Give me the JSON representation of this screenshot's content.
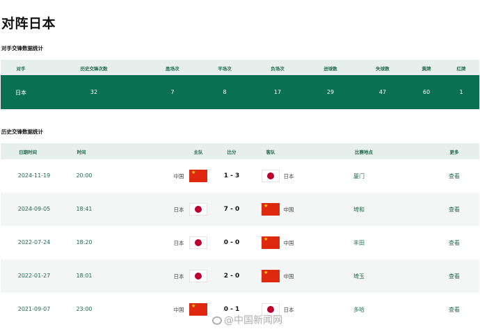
{
  "page": {
    "title": "对阵日本"
  },
  "stats": {
    "section_title": "对手交锋数据统计",
    "headers": [
      "对手",
      "历史交锋次数",
      "胜场次",
      "平场次",
      "负场次",
      "进球数",
      "失球数",
      "黄牌",
      "红牌"
    ],
    "row": [
      "日本",
      "32",
      "7",
      "8",
      "17",
      "29",
      "47",
      "60",
      "1"
    ]
  },
  "matches": {
    "section_title": "历史交锋数据统计",
    "headers": [
      "日期时间",
      "时间",
      "主队",
      "比分",
      "客队",
      "比赛地点",
      "更多"
    ],
    "rows": [
      {
        "date": "2024-11-19",
        "time": "20:00",
        "home": "中国",
        "home_flag": "china-flag-icon",
        "score": "1 - 3",
        "away": "日本",
        "away_flag": "japan-flag-icon",
        "venue": "厦门",
        "more": "查看"
      },
      {
        "date": "2024-09-05",
        "time": "18:41",
        "home": "日本",
        "home_flag": "japan-flag-icon",
        "score": "7 - 0",
        "away": "中国",
        "away_flag": "china-flag-icon",
        "venue": "埼和",
        "more": "查看"
      },
      {
        "date": "2022-07-24",
        "time": "18:20",
        "home": "日本",
        "home_flag": "japan-flag-icon",
        "score": "0 - 0",
        "away": "中国",
        "away_flag": "china-flag-icon",
        "venue": "丰田",
        "more": "查看"
      },
      {
        "date": "2022-01-27",
        "time": "18:01",
        "home": "日本",
        "home_flag": "japan-flag-icon",
        "score": "2 - 0",
        "away": "中国",
        "away_flag": "china-flag-icon",
        "venue": "埼玉",
        "more": "查看"
      },
      {
        "date": "2021-09-07",
        "time": "23:00",
        "home": "中国",
        "home_flag": "china-flag-icon",
        "score": "0 - 1",
        "away": "日本",
        "away_flag": "japan-flag-icon",
        "venue": "多哈",
        "more": "查看"
      }
    ]
  },
  "colors": {
    "accent": "#0a7150",
    "header_bg": "#e7efec",
    "link": "#1f6b4d"
  },
  "watermark": {
    "text": "@中国新闻网"
  }
}
